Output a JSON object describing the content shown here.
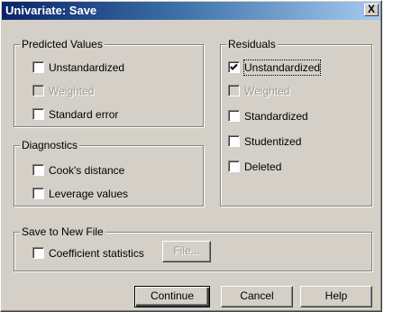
{
  "window": {
    "title": "Univariate: Save",
    "close_glyph": "X"
  },
  "predicted": {
    "legend": "Predicted Values",
    "items": [
      {
        "label": "Unstandardized",
        "checked": false,
        "enabled": true
      },
      {
        "label": "Weighted",
        "checked": false,
        "enabled": false
      },
      {
        "label": "Standard error",
        "checked": false,
        "enabled": true
      }
    ]
  },
  "diagnostics": {
    "legend": "Diagnostics",
    "items": [
      {
        "label": "Cook's distance",
        "checked": false,
        "enabled": true
      },
      {
        "label": "Leverage values",
        "checked": false,
        "enabled": true
      }
    ]
  },
  "residuals": {
    "legend": "Residuals",
    "items": [
      {
        "label": "Unstandardized",
        "checked": true,
        "enabled": true
      },
      {
        "label": "Weighted",
        "checked": false,
        "enabled": false
      },
      {
        "label": "Standardized",
        "checked": false,
        "enabled": true
      },
      {
        "label": "Studentized",
        "checked": false,
        "enabled": true
      },
      {
        "label": "Deleted",
        "checked": false,
        "enabled": true
      }
    ]
  },
  "savefile": {
    "legend": "Save to New File",
    "coef_label": "Coefficient statistics",
    "file_button": "File..."
  },
  "buttons": {
    "continue": "Continue",
    "cancel": "Cancel",
    "help": "Help"
  }
}
